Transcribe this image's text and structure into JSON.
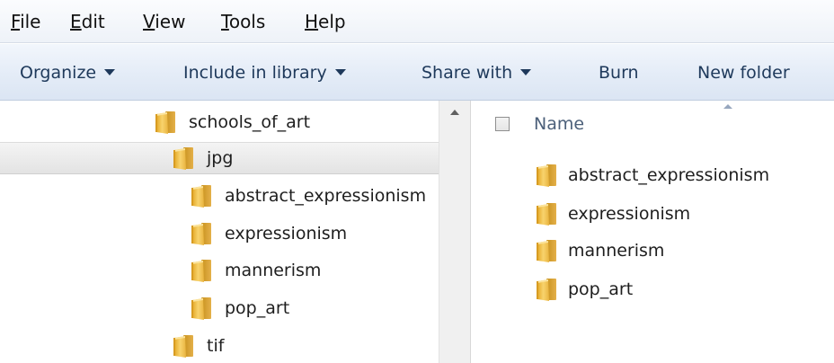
{
  "menubar": {
    "items": [
      {
        "accel": "F",
        "rest": "ile"
      },
      {
        "accel": "E",
        "rest": "dit"
      },
      {
        "accel": "V",
        "rest": "iew"
      },
      {
        "accel": "T",
        "rest": "ools"
      },
      {
        "accel": "H",
        "rest": "elp"
      }
    ]
  },
  "commandbar": {
    "organize": "Organize",
    "include_in_library": "Include in library",
    "share_with": "Share with",
    "burn": "Burn",
    "new_folder": "New folder"
  },
  "nav_tree": {
    "items": [
      {
        "label": "schools_of_art",
        "icon": "folder-icon"
      },
      {
        "label": "jpg",
        "icon": "folder-icon",
        "selected": true
      },
      {
        "label": "abstract_expressionism",
        "icon": "folder-icon"
      },
      {
        "label": "expressionism",
        "icon": "folder-icon"
      },
      {
        "label": "mannerism",
        "icon": "folder-icon"
      },
      {
        "label": "pop_art",
        "icon": "folder-icon"
      },
      {
        "label": "tif",
        "icon": "folder-icon"
      }
    ]
  },
  "content": {
    "column_header": "Name",
    "items": [
      {
        "label": "abstract_expressionism",
        "icon": "folder-icon"
      },
      {
        "label": "expressionism",
        "icon": "folder-icon"
      },
      {
        "label": "mannerism",
        "icon": "folder-icon"
      },
      {
        "label": "pop_art",
        "icon": "folder-icon"
      }
    ]
  },
  "colors": {
    "command_text": "#1e395b",
    "folder_body": "#f0c14b",
    "folder_dark": "#c8921d"
  }
}
